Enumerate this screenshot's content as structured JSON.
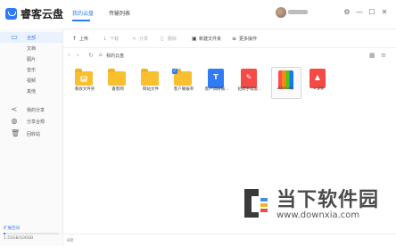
{
  "app": {
    "brand": "睿客云盘",
    "tabs": [
      {
        "label": "我的云盘",
        "active": true
      },
      {
        "label": "传输列表",
        "active": false
      }
    ],
    "window_controls": [
      "gear-icon",
      "minimize-icon",
      "maximize-icon",
      "close-icon"
    ],
    "accent": "#2f7cf6"
  },
  "sidebar": {
    "items": [
      {
        "label": "全部",
        "icon": "folder-icon",
        "active": true
      },
      {
        "label": "文档",
        "icon": "",
        "active": false
      },
      {
        "label": "图片",
        "icon": "",
        "active": false
      },
      {
        "label": "音乐",
        "icon": "",
        "active": false
      },
      {
        "label": "视频",
        "icon": "",
        "active": false
      },
      {
        "label": "其他",
        "icon": "",
        "active": false
      },
      {
        "label": "我的分享",
        "icon": "share-icon",
        "active": false
      },
      {
        "label": "分享合规",
        "icon": "shield-icon",
        "active": false
      },
      {
        "label": "回收站",
        "icon": "trash-icon",
        "active": false
      }
    ],
    "storage": {
      "label": "扩展空间",
      "usage_text": "1.55GB/100GB",
      "used_fraction": 0.0155
    }
  },
  "toolbar": {
    "upload": "上传",
    "download": "下载",
    "share": "分享",
    "delete": "删除",
    "new_folder": "新建文件夹",
    "more": "更多操作"
  },
  "pathbar": {
    "path": "我的云盘"
  },
  "files": [
    {
      "name": "看收文件夹",
      "type": "folder",
      "badge": "✉"
    },
    {
      "name": "睿客网",
      "type": "folder",
      "badge": ""
    },
    {
      "name": "网站文件",
      "type": "folder",
      "badge": ""
    },
    {
      "name": "客户确报率",
      "type": "folder",
      "badge": "",
      "checked": true
    },
    {
      "name": "客户调研报...",
      "type": "doc",
      "color": "#2f7cf6",
      "glyph": "T"
    },
    {
      "name": "招聘手续说...",
      "type": "pdf",
      "color": "#f54a45",
      "glyph": "✎"
    },
    {
      "name": "2005.zip",
      "type": "zip",
      "selected": true
    },
    {
      "name": "2.jpg",
      "type": "image",
      "color": "#f54a45",
      "glyph": "▲"
    }
  ],
  "footer": {
    "text": "8项"
  },
  "watermark": {
    "title": "当下软件园",
    "url": "www.downxia.com"
  }
}
